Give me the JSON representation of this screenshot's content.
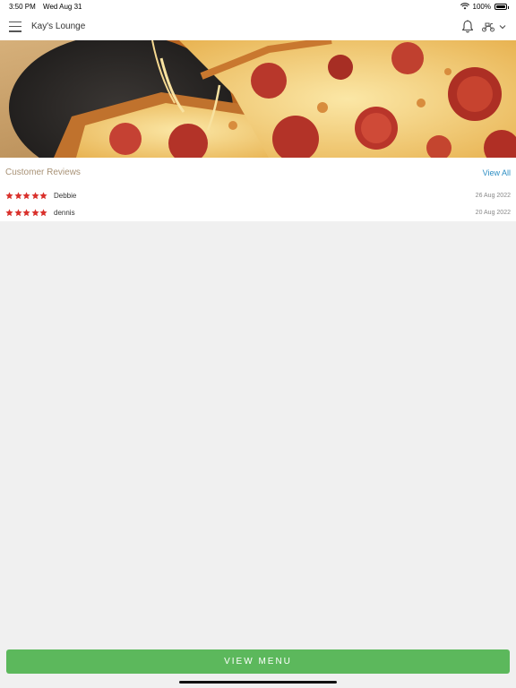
{
  "status_bar": {
    "time": "3:50 PM",
    "date": "Wed Aug 31",
    "battery": "100%",
    "battery_level": 1.0
  },
  "header": {
    "title": "Kay's Lounge",
    "menu_icon": "hamburger-icon",
    "bell_icon": "bell-icon",
    "order_icon": "scooter-icon",
    "chevron_icon": "chevron-down-icon"
  },
  "reviews": {
    "title": "Customer Reviews",
    "view_all": "View All",
    "star_color": "#d9302b",
    "items": [
      {
        "name": "Debbie",
        "date": "26 Aug 2022",
        "rating": 5
      },
      {
        "name": "dennis",
        "date": "20 Aug 2022",
        "rating": 5
      }
    ]
  },
  "cta": {
    "label": "VIEW MENU",
    "color": "#5cb85c"
  }
}
